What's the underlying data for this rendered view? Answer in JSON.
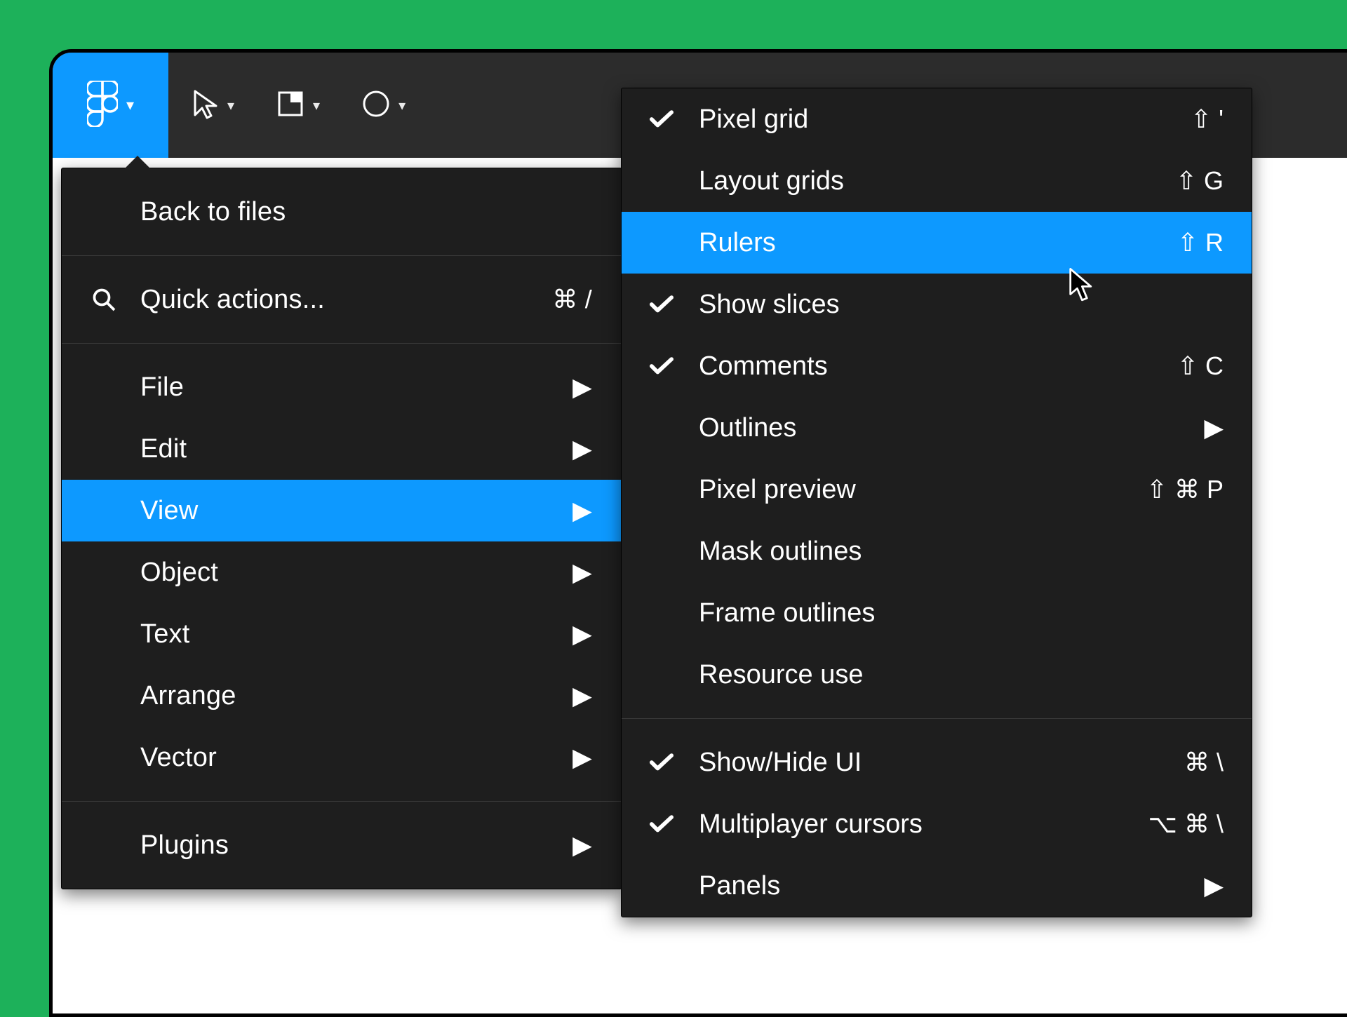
{
  "toolbar": {
    "tools": [
      "move",
      "frame",
      "shape"
    ]
  },
  "main_menu": {
    "back": "Back to files",
    "quick": {
      "label": "Quick actions...",
      "shortcut": "⌘ /"
    },
    "items": [
      {
        "label": "File",
        "selected": false
      },
      {
        "label": "Edit",
        "selected": false
      },
      {
        "label": "View",
        "selected": true
      },
      {
        "label": "Object",
        "selected": false
      },
      {
        "label": "Text",
        "selected": false
      },
      {
        "label": "Arrange",
        "selected": false
      },
      {
        "label": "Vector",
        "selected": false
      }
    ],
    "plugins": "Plugins"
  },
  "sub_menu": {
    "g1": [
      {
        "label": "Pixel grid",
        "shortcut": "⇧ '",
        "checked": true,
        "selected": false
      },
      {
        "label": "Layout grids",
        "shortcut": "⇧ G",
        "checked": false,
        "selected": false
      },
      {
        "label": "Rulers",
        "shortcut": "⇧ R",
        "checked": false,
        "selected": true
      },
      {
        "label": "Show slices",
        "shortcut": "",
        "checked": true,
        "selected": false
      },
      {
        "label": "Comments",
        "shortcut": "⇧ C",
        "checked": true,
        "selected": false
      },
      {
        "label": "Outlines",
        "shortcut": "",
        "checked": false,
        "selected": false,
        "arrow": true
      },
      {
        "label": "Pixel preview",
        "shortcut": "⇧ ⌘ P",
        "checked": false,
        "selected": false
      },
      {
        "label": "Mask outlines",
        "shortcut": "",
        "checked": false,
        "selected": false
      },
      {
        "label": "Frame outlines",
        "shortcut": "",
        "checked": false,
        "selected": false
      },
      {
        "label": "Resource use",
        "shortcut": "",
        "checked": false,
        "selected": false
      }
    ],
    "g2": [
      {
        "label": "Show/Hide UI",
        "shortcut": "⌘ \\",
        "checked": true,
        "selected": false
      },
      {
        "label": "Multiplayer cursors",
        "shortcut": "⌥ ⌘ \\",
        "checked": true,
        "selected": false
      },
      {
        "label": "Panels",
        "shortcut": "",
        "checked": false,
        "selected": false,
        "arrow": true
      }
    ]
  }
}
